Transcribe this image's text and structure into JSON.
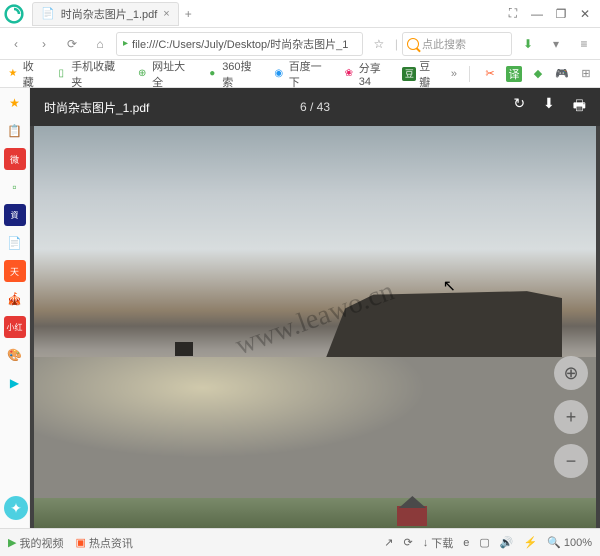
{
  "tab": {
    "title": "时尚杂志图片_1.pdf"
  },
  "window": {
    "restore": "❐",
    "minimize": "—",
    "close": "✕",
    "expand": "⛶"
  },
  "nav": {
    "back": "‹",
    "forward": "›",
    "reload": "⟳",
    "home": "⌂",
    "url": "file:///C:/Users/July/Desktop/时尚杂志图片_1",
    "star": "☆",
    "down_arrow": "▾",
    "menu": "≡"
  },
  "search": {
    "placeholder": "点此搜索"
  },
  "bookmarks": {
    "fav": "收藏",
    "mobile": "手机收藏夹",
    "sites": "网址大全",
    "360": "360搜索",
    "baidu": "百度一下",
    "share": "分享34",
    "douban": "豆瓣"
  },
  "pdf": {
    "filename": "时尚杂志图片_1.pdf",
    "pages": "6 / 43",
    "rotate": "↻",
    "download": "⬇",
    "print": "🖶",
    "fit": "⊕",
    "zoom_in": "+",
    "zoom_out": "−"
  },
  "watermark": "www.leawo.cn",
  "status": {
    "video": "我的视频",
    "news": "热点资讯",
    "arrow": "↗",
    "download": "下载",
    "e": "e",
    "speaker": "🔊",
    "speed": "⚡",
    "zoom": "100%"
  }
}
